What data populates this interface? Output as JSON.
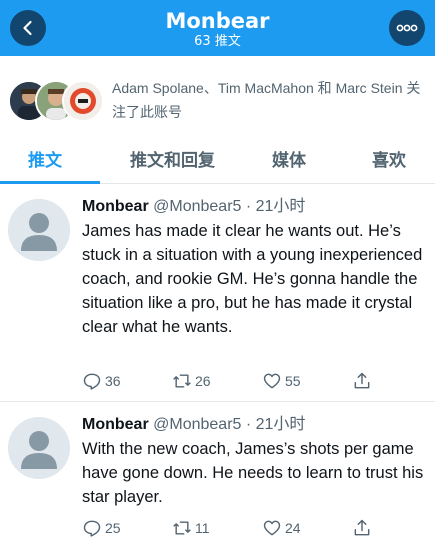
{
  "header": {
    "title": "Monbear",
    "subtitle": "63 推文",
    "color": "#1d9bf0"
  },
  "followed_by": {
    "text": "Adam Spolane、Tim MacMahon 和 Marc Stein 关注了此账号"
  },
  "tabs": [
    {
      "label": "推文",
      "active": true
    },
    {
      "label": "推文和回复",
      "active": false
    },
    {
      "label": "媒体",
      "active": false
    },
    {
      "label": "喜欢",
      "active": false
    }
  ],
  "tweets": [
    {
      "name": "Monbear",
      "handle": "@Monbear5 · 21小时",
      "text": "James has made it clear he wants out. He’s stuck in a situation with a young inexperienced coach, and rookie GM. He’s gonna handle the situation like a pro, but he has made it crystal clear what he wants.",
      "replies": "36",
      "retweets": "26",
      "likes": "55"
    },
    {
      "name": "Monbear",
      "handle": "@Monbear5 · 21小时",
      "text": "With the new coach, James’s shots per game have gone down. He needs to learn to trust his star player.",
      "replies": "25",
      "retweets": "11",
      "likes": "24"
    }
  ]
}
